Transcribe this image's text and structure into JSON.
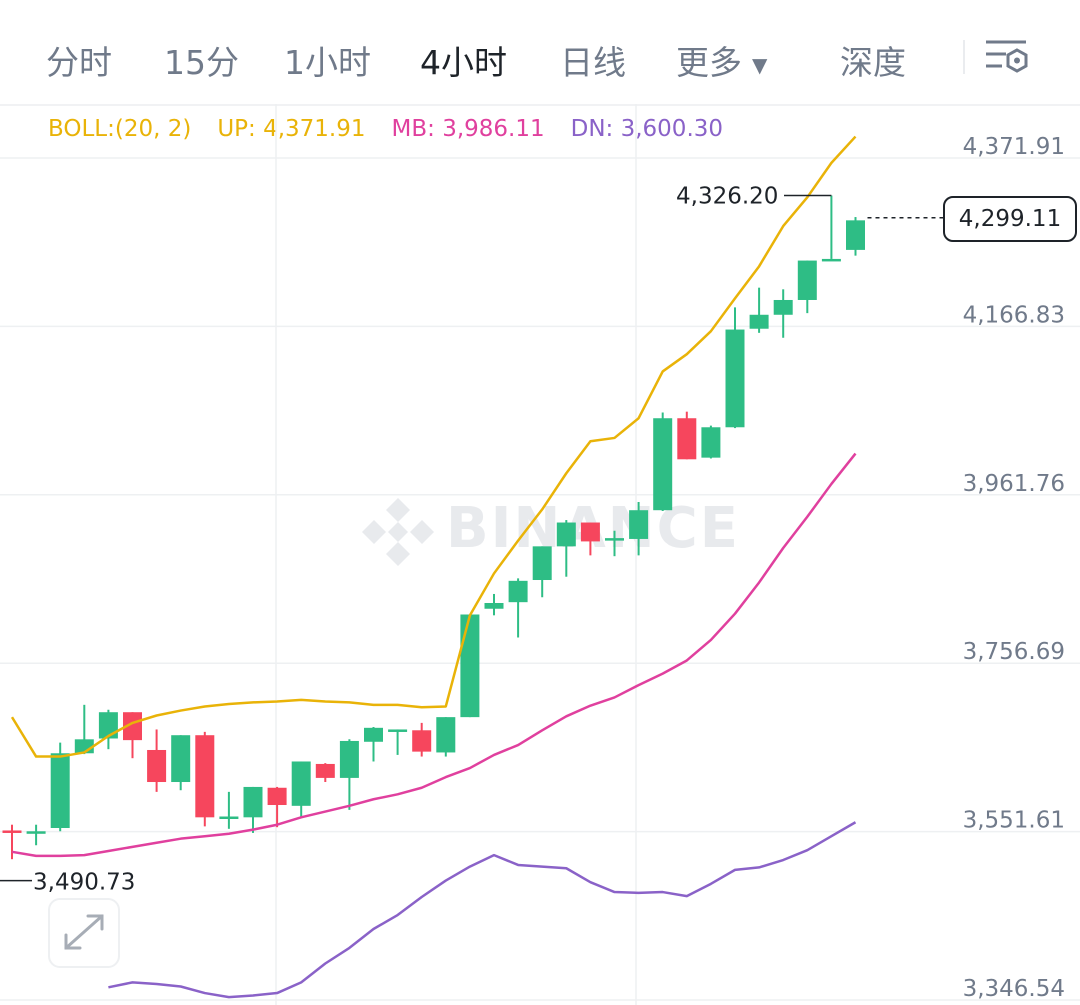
{
  "tabs": [
    {
      "label": "分时",
      "active": false
    },
    {
      "label": "15分",
      "active": false
    },
    {
      "label": "1小时",
      "active": false
    },
    {
      "label": "4小时",
      "active": true
    },
    {
      "label": "日线",
      "active": false
    },
    {
      "label": "更多",
      "active": false
    },
    {
      "label": "深度",
      "active": false
    }
  ],
  "settings_icon": "chart-settings-icon",
  "boll": {
    "label": "BOLL:(20, 2)",
    "up": "UP: 4,371.91",
    "mb": "MB: 3,986.11",
    "dn": "DN: 3,600.30",
    "colors": {
      "up": "#e9b308",
      "mb": "#e0409e",
      "dn": "#8a62c8"
    }
  },
  "watermark": "BINANCE",
  "expand_icon": "expand-arrows-icon",
  "colors": {
    "bull": "#2ebd85",
    "bear": "#f6465d",
    "grid": "#eef0f2",
    "text": "#707a8a"
  },
  "chart_data": {
    "type": "candlestick",
    "y_ticks": [
      "4,371.91",
      "4,166.83",
      "3,961.76",
      "3,756.69",
      "3,551.61",
      "3,346.54"
    ],
    "y_tick_values": [
      4371.91,
      4166.83,
      3961.76,
      3756.69,
      3551.61,
      3346.54
    ],
    "ylim": [
      3346.54,
      4371.91
    ],
    "high_annotation": {
      "label": "4,326.20",
      "value": 4326.2
    },
    "low_annotation": {
      "label": "3,490.73",
      "value": 3490.73
    },
    "last_price": {
      "label": "4,299.11",
      "value": 4299.11
    },
    "candles": [
      {
        "o": 3553,
        "h": 3560,
        "l": 3518,
        "c": 3550
      },
      {
        "o": 3550,
        "h": 3560,
        "l": 3535,
        "c": 3552
      },
      {
        "o": 3556,
        "h": 3660,
        "l": 3552,
        "c": 3647
      },
      {
        "o": 3647,
        "h": 3706,
        "l": 3646,
        "c": 3664
      },
      {
        "o": 3665,
        "h": 3700,
        "l": 3652,
        "c": 3697
      },
      {
        "o": 3697,
        "h": 3697,
        "l": 3641,
        "c": 3663
      },
      {
        "o": 3651,
        "h": 3676,
        "l": 3600,
        "c": 3612
      },
      {
        "o": 3612,
        "h": 3666,
        "l": 3602,
        "c": 3669
      },
      {
        "o": 3669,
        "h": 3673,
        "l": 3558,
        "c": 3569
      },
      {
        "o": 3568,
        "h": 3600,
        "l": 3555,
        "c": 3570
      },
      {
        "o": 3569,
        "h": 3604,
        "l": 3550,
        "c": 3606
      },
      {
        "o": 3605,
        "h": 3606,
        "l": 3557,
        "c": 3584
      },
      {
        "o": 3583,
        "h": 3635,
        "l": 3570,
        "c": 3637
      },
      {
        "o": 3634,
        "h": 3635,
        "l": 3612,
        "c": 3617
      },
      {
        "o": 3617,
        "h": 3664,
        "l": 3578,
        "c": 3662
      },
      {
        "o": 3661,
        "h": 3679,
        "l": 3637,
        "c": 3678
      },
      {
        "o": 3674,
        "h": 3676,
        "l": 3645,
        "c": 3676
      },
      {
        "o": 3675,
        "h": 3684,
        "l": 3643,
        "c": 3649
      },
      {
        "o": 3648,
        "h": 3672,
        "l": 3643,
        "c": 3691
      },
      {
        "o": 3691,
        "h": 3812,
        "l": 3692,
        "c": 3816
      },
      {
        "o": 3823,
        "h": 3841,
        "l": 3815,
        "c": 3830
      },
      {
        "o": 3831,
        "h": 3860,
        "l": 3788,
        "c": 3857
      },
      {
        "o": 3858,
        "h": 3898,
        "l": 3837,
        "c": 3899
      },
      {
        "o": 3899,
        "h": 3931,
        "l": 3862,
        "c": 3928
      },
      {
        "o": 3928,
        "h": 3911,
        "l": 3888,
        "c": 3905
      },
      {
        "o": 3906,
        "h": 3918,
        "l": 3887,
        "c": 3909
      },
      {
        "o": 3908,
        "h": 3953,
        "l": 3888,
        "c": 3943
      },
      {
        "o": 3943,
        "h": 4062,
        "l": 3942,
        "c": 4055
      },
      {
        "o": 4055,
        "h": 4063,
        "l": 4005,
        "c": 4005
      },
      {
        "o": 4007,
        "h": 4046,
        "l": 4006,
        "c": 4044
      },
      {
        "o": 4044,
        "h": 4190,
        "l": 4043,
        "c": 4163
      },
      {
        "o": 4164,
        "h": 4214,
        "l": 4159,
        "c": 4181
      },
      {
        "o": 4181,
        "h": 4212,
        "l": 4153,
        "c": 4199
      },
      {
        "o": 4199,
        "h": 4240,
        "l": 4183,
        "c": 4247
      },
      {
        "o": 4249,
        "h": 4326.2,
        "l": 4249,
        "c": 4249
      },
      {
        "o": 4260,
        "h": 4300,
        "l": 4253,
        "c": 4296
      }
    ],
    "series": [
      {
        "name": "UP",
        "color": "#e9b308",
        "values": [
          3691,
          3643,
          3643,
          3648,
          3668,
          3684,
          3693,
          3699,
          3704,
          3707,
          3709,
          3710,
          3712,
          3710,
          3709,
          3706,
          3706,
          3703,
          3704,
          3815,
          3866,
          3906,
          3944,
          3988,
          4027,
          4031,
          4055,
          4112,
          4133,
          4161,
          4201,
          4240,
          4289,
          4324,
          4366,
          4398
        ]
      },
      {
        "name": "MB",
        "color": "#e0409e",
        "values": [
          3527,
          3522,
          3522,
          3523,
          3528,
          3533,
          3538,
          3543,
          3546,
          3549,
          3554,
          3560,
          3569,
          3576,
          3583,
          3591,
          3597,
          3605,
          3618,
          3629,
          3645,
          3657,
          3675,
          3692,
          3705,
          3715,
          3730,
          3744,
          3760,
          3785,
          3817,
          3855,
          3897,
          3935,
          3975,
          4012
        ]
      },
      {
        "name": "DN",
        "color": "#8a62c8",
        "values": [
          3362,
          3368,
          3366,
          3363,
          3355,
          3350,
          3352,
          3355,
          3368,
          3391,
          3410,
          3433,
          3450,
          3472,
          3492,
          3509,
          3523,
          3511,
          3509,
          3507,
          3490,
          3478,
          3477,
          3478,
          3473,
          3488,
          3505,
          3508,
          3517,
          3529,
          3546,
          3563
        ]
      }
    ],
    "dn_start_index": 0,
    "grid": true
  }
}
